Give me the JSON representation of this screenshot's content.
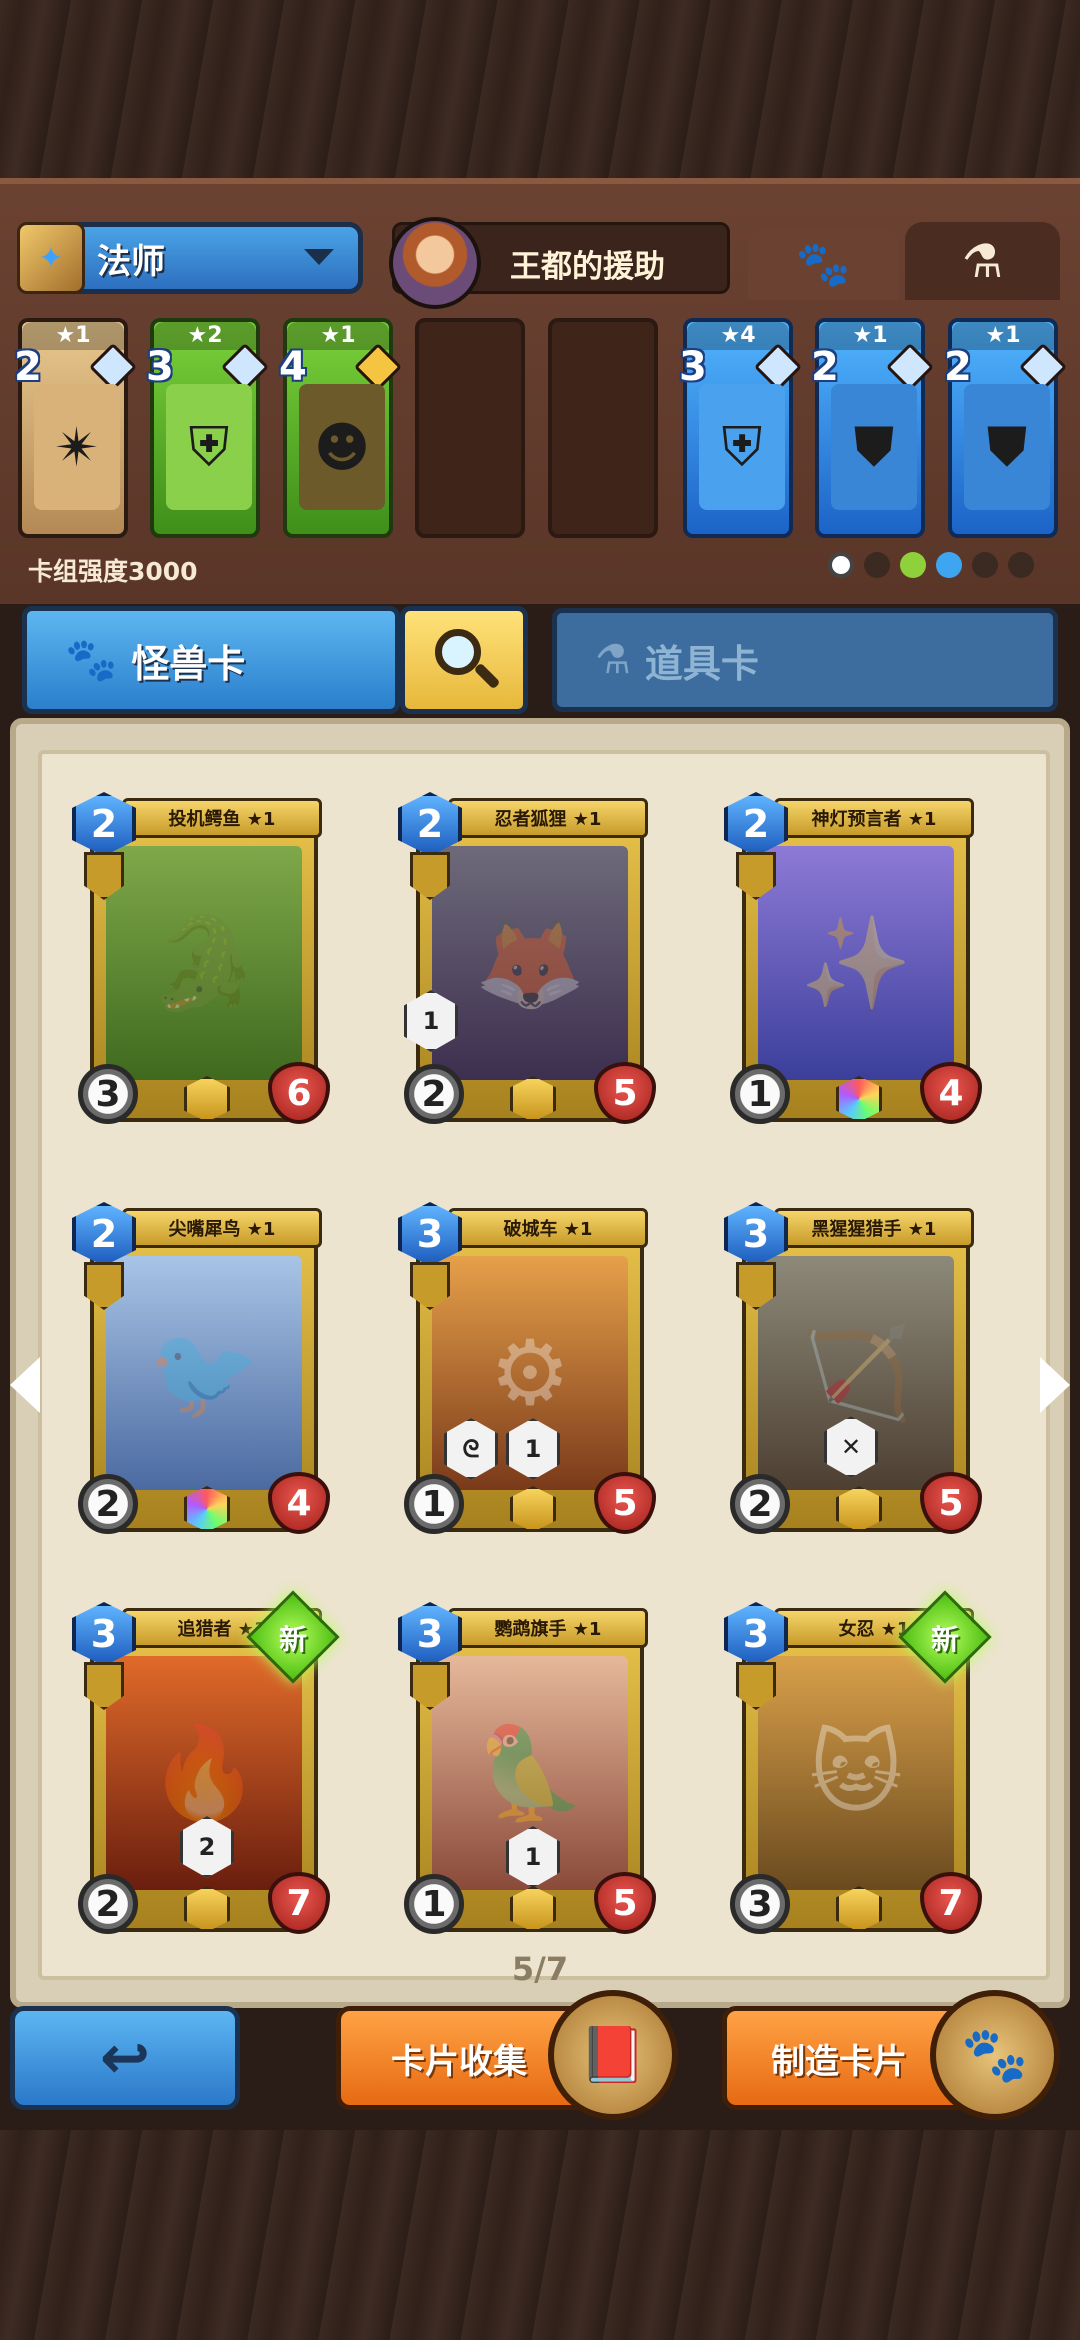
{
  "header": {
    "class_name": "法师",
    "hero_name": "王都的援助",
    "tab_monster_icon": "paw-icon",
    "tab_item_icon": "flask-icon"
  },
  "deck": {
    "slots": [
      {
        "stars": "★1",
        "cost": "2",
        "color": "#c9a06a",
        "art": "shuriken"
      },
      {
        "stars": "★2",
        "cost": "3",
        "color": "#58b52a",
        "art": "banner"
      },
      {
        "stars": "★1",
        "cost": "4",
        "color": "#58b52a",
        "art": "bronze-mask"
      },
      {
        "stars": "★4",
        "cost": "3",
        "color": "#2b8ce0",
        "art": "banner"
      },
      {
        "stars": "★1",
        "cost": "2",
        "color": "#2b8ce0",
        "art": "armor"
      },
      {
        "stars": "★1",
        "cost": "2",
        "color": "#2b8ce0",
        "art": "armor"
      }
    ],
    "power_label": "卡组强度3000"
  },
  "categories": {
    "monster_label": "怪兽卡",
    "item_label": "道具卡"
  },
  "cards": [
    {
      "title": "投机鳄鱼 ★1",
      "cost": "2",
      "attack": "3",
      "health": "6",
      "art_color": "#5a8a2a",
      "badge": "",
      "is_new": false
    },
    {
      "title": "忍者狐狸 ★1",
      "cost": "2",
      "attack": "2",
      "health": "5",
      "art_color": "#6b4c8a",
      "badge": "1",
      "is_new": false
    },
    {
      "title": "神灯预言者 ★1",
      "cost": "2",
      "attack": "1",
      "health": "4",
      "art_color": "#4c5fb0",
      "badge": "",
      "is_new": false
    },
    {
      "title": "尖嘴犀鸟 ★1",
      "cost": "2",
      "attack": "2",
      "health": "4",
      "art_color": "#6d8fb8",
      "badge": "",
      "is_new": false
    },
    {
      "title": "破城车 ★1",
      "cost": "3",
      "attack": "1",
      "health": "5",
      "art_color": "#b0552a",
      "badge": "1",
      "is_new": false
    },
    {
      "title": "黑猩猩猎手 ★1",
      "cost": "3",
      "attack": "2",
      "health": "5",
      "art_color": "#7d6a52",
      "badge": "",
      "is_new": false
    },
    {
      "title": "追猎者 ★1",
      "cost": "3",
      "attack": "2",
      "health": "7",
      "art_color": "#b8481e",
      "badge": "2",
      "is_new": true
    },
    {
      "title": "鹦鹉旗手 ★1",
      "cost": "3",
      "attack": "1",
      "health": "5",
      "art_color": "#a85a3a",
      "badge": "1",
      "is_new": false
    },
    {
      "title": "女忍 ★1",
      "cost": "3",
      "attack": "3",
      "health": "7",
      "art_color": "#8a6a2a",
      "badge": "",
      "is_new": true
    }
  ],
  "new_label": "新",
  "pagination": "5/7",
  "buttons": {
    "back_icon": "back-arrow-icon",
    "collection_label": "卡片收集",
    "craft_label": "制造卡片"
  }
}
